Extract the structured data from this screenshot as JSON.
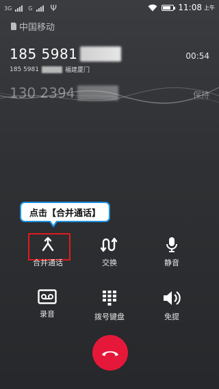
{
  "status_bar": {
    "sim1_label": "3G",
    "sim2_label": "G",
    "time": "11:08",
    "ampm": "上午",
    "battery_level": 0.8
  },
  "carrier": "中国移动",
  "active_call": {
    "number_prefix": "185 5981",
    "number_detail_prefix": "185 5981",
    "location": "福建厦门",
    "duration": "00:54"
  },
  "held_call": {
    "number_prefix": "130 2394",
    "status": "保持"
  },
  "tooltip": "点击【合并通话】",
  "controls": [
    {
      "label": "合并通话",
      "icon": "merge-icon"
    },
    {
      "label": "交换",
      "icon": "swap-icon"
    },
    {
      "label": "静音",
      "icon": "microphone-icon"
    },
    {
      "label": "录音",
      "icon": "record-icon"
    },
    {
      "label": "拨号键盘",
      "icon": "dialpad-icon"
    },
    {
      "label": "免提",
      "icon": "speaker-icon"
    }
  ],
  "hangup_color": "#e5183a",
  "highlight_color": "#e01b1b",
  "tooltip_border_color": "#1d8fe0"
}
